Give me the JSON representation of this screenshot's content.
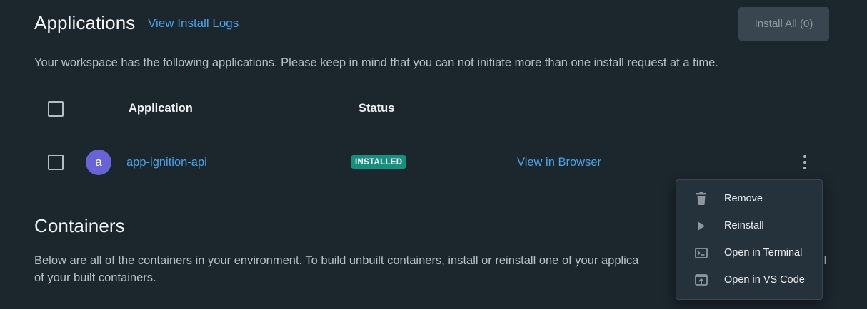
{
  "applications": {
    "title": "Applications",
    "logs_link": "View Install Logs",
    "install_all_label": "Install All (0)",
    "description": "Your workspace has the following applications. Please keep in mind that you can not initiate more than one install request at a time.",
    "columns": {
      "application": "Application",
      "status": "Status"
    },
    "rows": [
      {
        "avatar_letter": "a",
        "name": "app-ignition-api",
        "status": "INSTALLED",
        "action_link": "View in Browser"
      }
    ]
  },
  "context_menu": {
    "items": [
      {
        "label": "Remove",
        "icon": "trash-icon"
      },
      {
        "label": "Reinstall",
        "icon": "play-icon"
      },
      {
        "label": "Open in Terminal",
        "icon": "terminal-icon"
      },
      {
        "label": "Open in VS Code",
        "icon": "open-in-window-icon"
      }
    ]
  },
  "containers": {
    "title": "Containers",
    "description_line1": "Below are all of the containers in your environment. To build unbuilt containers, install or reinstall one of your applica",
    "description_tail": "ll",
    "description_line2": "of your built containers."
  },
  "colors": {
    "background": "#1c262d",
    "link": "#4aa3e8",
    "badge_installed": "#178f7f",
    "avatar": "#6864d6"
  }
}
